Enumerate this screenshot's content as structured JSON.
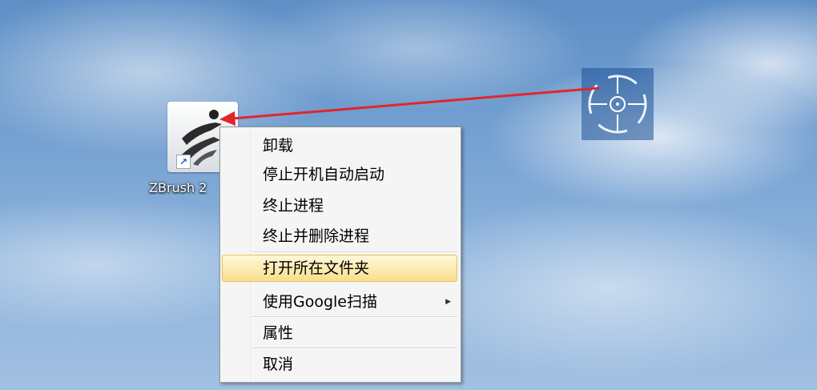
{
  "desktop": {
    "shortcut": {
      "label": "ZBrush 2",
      "shortcut_arrow": "↗",
      "icon": "zbrush-app-icon"
    },
    "target_widget": {
      "icon": "crosshair-target-icon"
    }
  },
  "context_menu": {
    "items": [
      {
        "label": "卸载"
      },
      {
        "label": "停止开机自动启动"
      },
      {
        "label": "终止进程"
      },
      {
        "label": "终止并删除进程"
      },
      {
        "label": "打开所在文件夹",
        "highlighted": true
      },
      {
        "label": "使用Google扫描",
        "submenu_arrow": "▶"
      },
      {
        "label": "属性"
      },
      {
        "label": "取消"
      }
    ]
  },
  "colors": {
    "arrow": "#e0262b",
    "highlight": "#fcebb0",
    "menu_bg": "#f5f5f5"
  }
}
